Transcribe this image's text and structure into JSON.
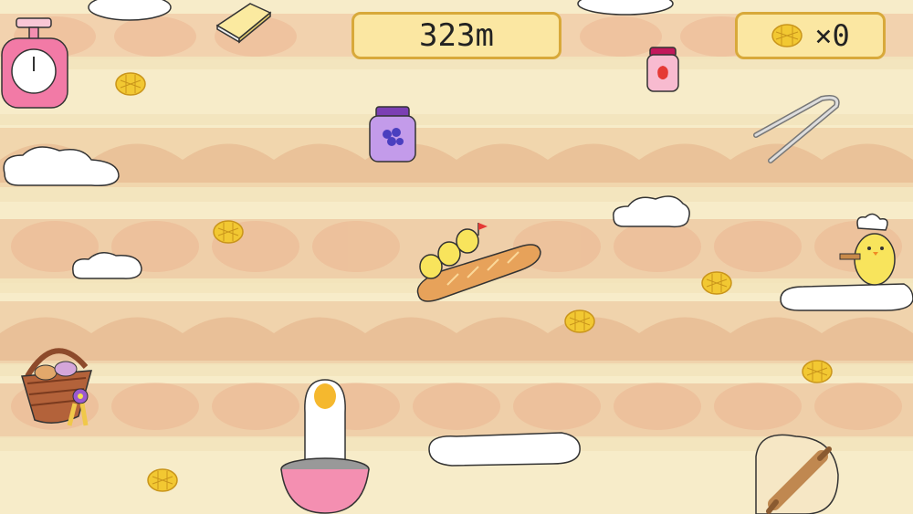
{
  "hud": {
    "distance": "323m",
    "coins": "×0"
  },
  "scene": {
    "coin_icon": "melon-pan-icon",
    "items": [
      "kitchen-scale-icon",
      "butter-icon",
      "strawberry-jam-icon",
      "blueberry-jam-icon",
      "tongs-icon",
      "bread-basket-icon",
      "rolling-pin-icon",
      "mixing-bowl-icon",
      "chef-chick",
      "chick-riders-on-baguette"
    ]
  },
  "colors": {
    "hud_fill": "#fbe7a2",
    "hud_border": "#d8a93a",
    "coin": "#f2c832",
    "background": "#f7ecc9"
  }
}
